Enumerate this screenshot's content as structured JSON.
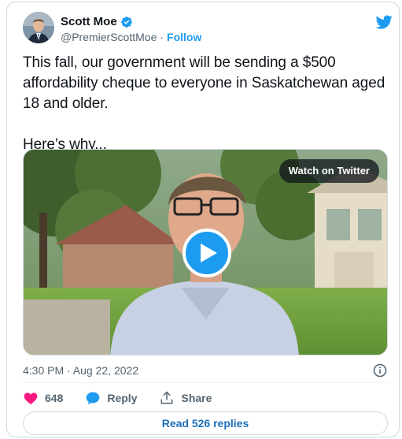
{
  "author": {
    "name": "Scott Moe",
    "handle": "@PremierScottMoe",
    "separator": "·",
    "follow_label": "Follow"
  },
  "tweet": {
    "text": "This fall, our government will be sending a $500 affordability cheque to everyone in Saskatchewan aged 18 and older.\n\nHere’s why..."
  },
  "media": {
    "watch_label": "Watch on Twitter"
  },
  "meta": {
    "timestamp": "4:30 PM · Aug 22, 2022"
  },
  "actions": {
    "like_count": "648",
    "reply_label": "Reply",
    "share_label": "Share"
  },
  "footer": {
    "read_replies_label": "Read 526 replies"
  },
  "colors": {
    "brand": "#1d9bf0",
    "like": "#f91880",
    "text": "#0f1419",
    "muted": "#536471"
  },
  "icons": [
    "verified-badge-icon",
    "twitter-bird-icon",
    "play-icon",
    "info-icon",
    "heart-icon",
    "reply-bubble-icon",
    "share-icon"
  ]
}
